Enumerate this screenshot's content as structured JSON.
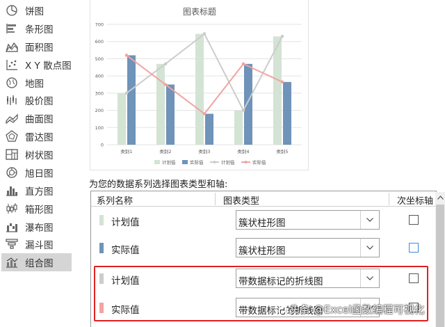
{
  "sidebar": {
    "items": [
      {
        "label": "饼图",
        "icon": "pie-chart-icon",
        "selected": false
      },
      {
        "label": "条形图",
        "icon": "bar-chart-icon",
        "selected": false
      },
      {
        "label": "面积图",
        "icon": "area-chart-icon",
        "selected": false
      },
      {
        "label": "X Y 散点图",
        "icon": "scatter-chart-icon",
        "selected": false
      },
      {
        "label": "地图",
        "icon": "map-chart-icon",
        "selected": false
      },
      {
        "label": "股价图",
        "icon": "stock-chart-icon",
        "selected": false
      },
      {
        "label": "曲面图",
        "icon": "surface-chart-icon",
        "selected": false
      },
      {
        "label": "雷达图",
        "icon": "radar-chart-icon",
        "selected": false
      },
      {
        "label": "树状图",
        "icon": "treemap-chart-icon",
        "selected": false
      },
      {
        "label": "旭日图",
        "icon": "sunburst-chart-icon",
        "selected": false
      },
      {
        "label": "直方图",
        "icon": "histogram-chart-icon",
        "selected": false
      },
      {
        "label": "箱形图",
        "icon": "boxplot-chart-icon",
        "selected": false
      },
      {
        "label": "瀑布图",
        "icon": "waterfall-chart-icon",
        "selected": false
      },
      {
        "label": "漏斗图",
        "icon": "funnel-chart-icon",
        "selected": false
      },
      {
        "label": "组合图",
        "icon": "combo-chart-icon",
        "selected": true
      }
    ]
  },
  "chart_data": {
    "type": "bar",
    "title": "图表标题",
    "categories": [
      "类别1",
      "类别2",
      "类别3",
      "类别4",
      "类别5"
    ],
    "ylim": [
      0,
      700
    ],
    "yticks": [
      0,
      100,
      200,
      300,
      400,
      500,
      600,
      700
    ],
    "grid": true,
    "legend_position": "bottom",
    "series": [
      {
        "name": "计划值",
        "kind": "bar",
        "color": "#d3e3d4",
        "values": [
          300,
          470,
          645,
          200,
          630
        ]
      },
      {
        "name": "实际值",
        "kind": "bar",
        "color": "#6f93b9",
        "values": [
          520,
          350,
          180,
          470,
          365
        ]
      },
      {
        "name": "计划值",
        "kind": "line",
        "color": "#cccccc",
        "values": [
          300,
          470,
          645,
          200,
          630
        ]
      },
      {
        "name": "实际值",
        "kind": "line",
        "color": "#f2a3a2",
        "values": [
          520,
          350,
          180,
          470,
          365
        ]
      }
    ]
  },
  "series_config": {
    "prompt": "为您的数据系列选择图表类型和轴:",
    "headers": {
      "name": "系列名称",
      "type": "图表类型",
      "secondary": "次坐标轴"
    },
    "rows": [
      {
        "name": "计划值",
        "color": "#d3e3d4",
        "chart_type": "簇状柱形图",
        "secondary": false
      },
      {
        "name": "实际值",
        "color": "#6f93b9",
        "chart_type": "簇状柱形图",
        "secondary": false
      },
      {
        "name": "计划值",
        "color": "#cccccc",
        "chart_type": "带数据标记的折线图",
        "secondary": false
      },
      {
        "name": "实际值",
        "color": "#f2a3a2",
        "chart_type": "带数据标记的折线图",
        "secondary": false
      }
    ]
  },
  "watermark": {
    "text": "头条 @Excel函数编程可视化"
  },
  "colors": {
    "highlight": "#e02020",
    "selected_bg": "#d5d5d5"
  }
}
